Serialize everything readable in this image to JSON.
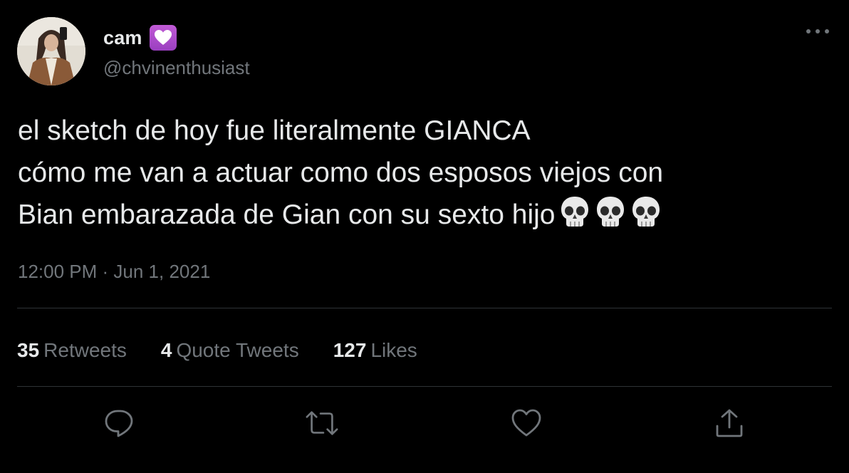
{
  "author": {
    "display_name": "cam",
    "handle": "@chvinenthusiast",
    "badge_icon": "purple-heart-icon",
    "badge_color": "#b04fcf"
  },
  "tweet": {
    "lines": [
      "el sketch de hoy fue literalmente GIANCA",
      "cómo me van a actuar como dos esposos viejos con",
      "Bian embarazada de Gian con su sexto hijo"
    ],
    "emoji": [
      "skull-emoji",
      "skull-emoji",
      "skull-emoji"
    ],
    "timestamp": "12:00 PM · Jun 1, 2021"
  },
  "stats": [
    {
      "count": "35",
      "label": "Retweets"
    },
    {
      "count": "4",
      "label": "Quote Tweets"
    },
    {
      "count": "127",
      "label": "Likes"
    }
  ],
  "actions": {
    "reply_icon": "reply-icon",
    "retweet_icon": "retweet-icon",
    "like_icon": "heart-outline-icon",
    "share_icon": "share-icon",
    "more_icon": "more-icon"
  },
  "colors": {
    "background": "#000000",
    "text_primary": "#e7e9ea",
    "text_secondary": "#71767b",
    "divider": "#2f3336"
  }
}
